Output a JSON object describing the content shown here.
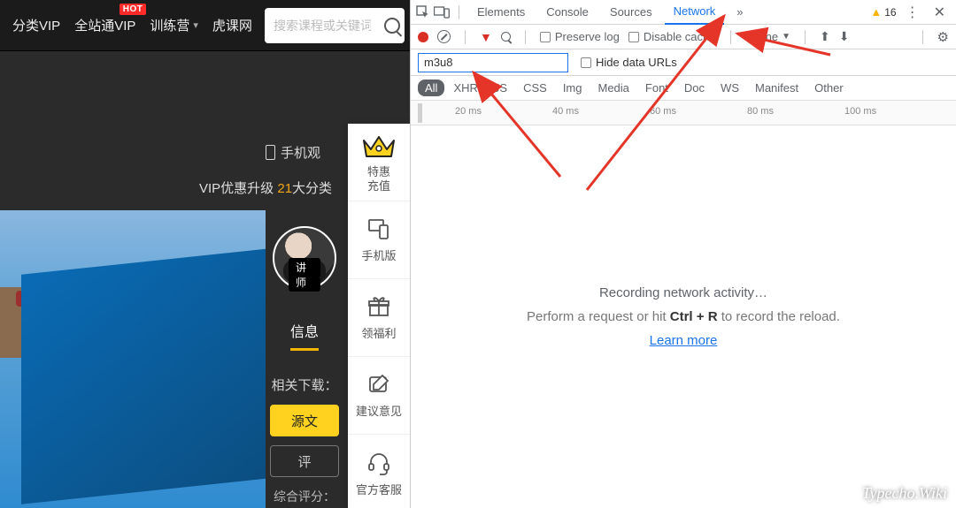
{
  "site": {
    "menu": {
      "cat": "分类VIP",
      "all": "全站通VIP",
      "camp": "训练营",
      "brand": "虎课网",
      "hot": "HOT"
    },
    "search_placeholder": "搜索课程或关键词",
    "mobile": "手机观",
    "vip_prefix": "VIP优惠升级 ",
    "vip_gold": "21",
    "vip_suffix": "大分类",
    "avatar_tag": "讲师",
    "tab_info": "信息",
    "download_label": "相关下载：",
    "btn_source": "源文",
    "btn_review": "评",
    "rating_label": "综合评分：",
    "dock": {
      "recharge1": "特惠",
      "recharge2": "充值",
      "mobile": "手机版",
      "bonus": "领福利",
      "feedback": "建议意见",
      "support": "官方客服"
    }
  },
  "dev": {
    "tabs": {
      "elements": "Elements",
      "console": "Console",
      "sources": "Sources",
      "network": "Network",
      "more": "»"
    },
    "warn_count": "16",
    "toolbar": {
      "preserve": "Preserve log",
      "disable_cache": "Disable cache",
      "online": "Online"
    },
    "filter_value": "m3u8",
    "hide_urls": "Hide data URLs",
    "types": {
      "all": "All",
      "xhr": "XHR",
      "js": "JS",
      "css": "CSS",
      "img": "Img",
      "media": "Media",
      "font": "Font",
      "doc": "Doc",
      "ws": "WS",
      "manifest": "Manifest",
      "other": "Other"
    },
    "ticks": {
      "t20": "20 ms",
      "t40": "40 ms",
      "t60": "60 ms",
      "t80": "80 ms",
      "t100": "100 ms"
    },
    "msg1": "Recording network activity…",
    "msg2a": "Perform a request or hit ",
    "msg2b": "Ctrl + R",
    "msg2c": " to record the reload.",
    "learn": "Learn more"
  },
  "watermark": "Typecho.Wiki"
}
